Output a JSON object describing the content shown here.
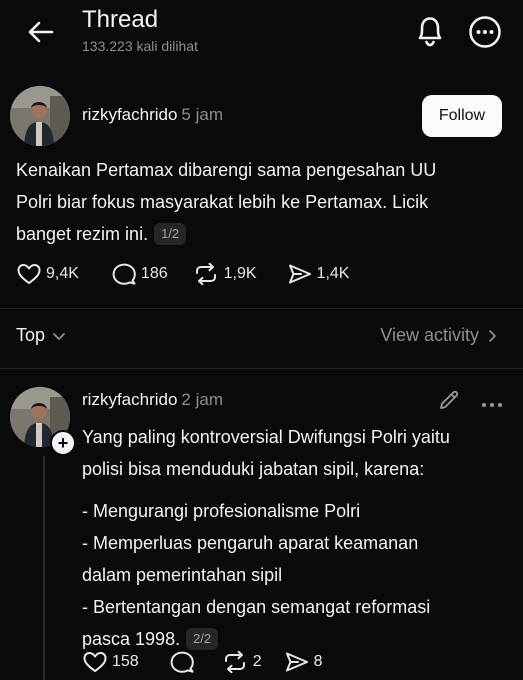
{
  "header": {
    "title": "Thread",
    "views": "133.223 kali dilihat"
  },
  "post1": {
    "username": "rizkyfachrido",
    "time": "5 jam",
    "follow_label": "Follow",
    "text_lines": [
      "Kenaikan Pertamax dibarengi sama pengesahan UU",
      "Polri biar fokus masyarakat lebih ke Pertamax. Licik",
      "banget rezim ini."
    ],
    "pager": "1/2",
    "likes": "9,4K",
    "comments": "186",
    "reposts": "1,9K",
    "shares": "1,4K"
  },
  "sort": {
    "label": "Top",
    "view_activity": "View activity"
  },
  "post2": {
    "username": "rizkyfachrido",
    "time": "2 jam",
    "text_lines": [
      "Yang paling kontroversial Dwifungsi Polri yaitu",
      "polisi bisa menduduki jabatan sipil, karena:",
      "- Mengurangi profesionalisme Polri",
      "- Memperluas pengaruh aparat keamanan",
      "dalam pemerintahan sipil",
      "- Bertentangan dengan semangat reformasi",
      "pasca 1998."
    ],
    "pager": "2/2",
    "likes": "158",
    "comments": "",
    "reposts": "2",
    "shares": "8"
  },
  "icons": {
    "back": "arrow-left-icon",
    "bell": "bell-icon",
    "more": "more-circle-icon",
    "like": "heart-icon",
    "comment": "comment-icon",
    "repost": "repost-icon",
    "share": "send-icon",
    "edit": "pencil-icon",
    "menu": "ellipsis-icon"
  }
}
